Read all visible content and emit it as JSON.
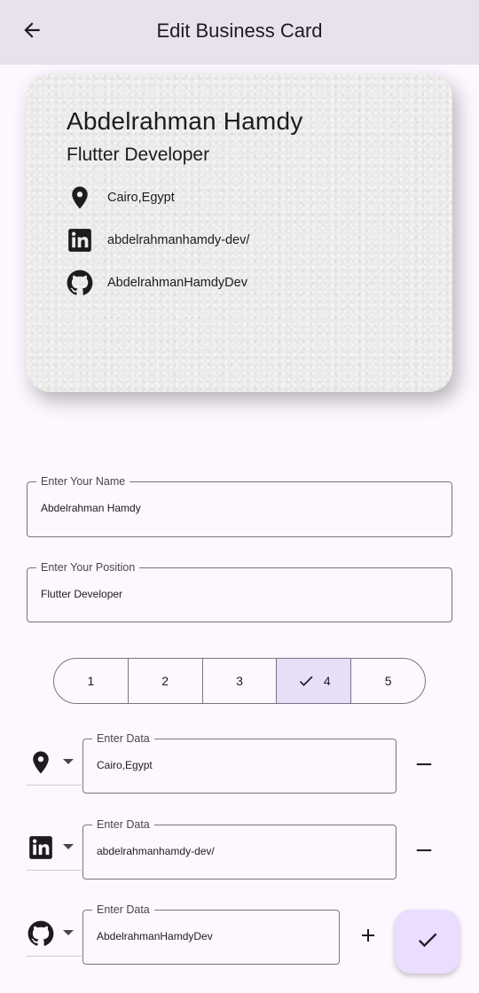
{
  "appbar": {
    "title": "Edit Business Card",
    "back_icon": "arrow-back-icon"
  },
  "card": {
    "name": "Abdelrahman Hamdy",
    "position": "Flutter Developer",
    "items": [
      {
        "icon": "location-pin-icon",
        "text": "Cairo,Egypt"
      },
      {
        "icon": "linkedin-icon",
        "text": "abdelrahmanhamdy-dev/"
      },
      {
        "icon": "github-icon",
        "text": "AbdelrahmanHamdyDev"
      }
    ]
  },
  "form": {
    "name_field": {
      "label": "Enter Your Name",
      "value": "Abdelrahman Hamdy"
    },
    "position_field": {
      "label": "Enter Your Position",
      "value": "Flutter Developer"
    }
  },
  "segmented": {
    "options": [
      "1",
      "2",
      "3",
      "4",
      "5"
    ],
    "selected": "4"
  },
  "data_rows": [
    {
      "icon": "location-pin-icon",
      "label": "Enter Data",
      "value": "Cairo,Egypt",
      "action": "remove"
    },
    {
      "icon": "linkedin-icon",
      "label": "Enter Data",
      "value": "abdelrahmanhamdy-dev/",
      "action": "remove"
    },
    {
      "icon": "github-icon",
      "label": "Enter Data",
      "value": "AbdelrahmanHamdyDev",
      "action": "add"
    }
  ],
  "fab": {
    "icon": "check-icon"
  },
  "colors": {
    "background": "#fdf7ff",
    "appbar": "#e8e2ef",
    "selected_segment": "#e8def8",
    "fab": "#eaddff",
    "outline": "#79747e"
  }
}
